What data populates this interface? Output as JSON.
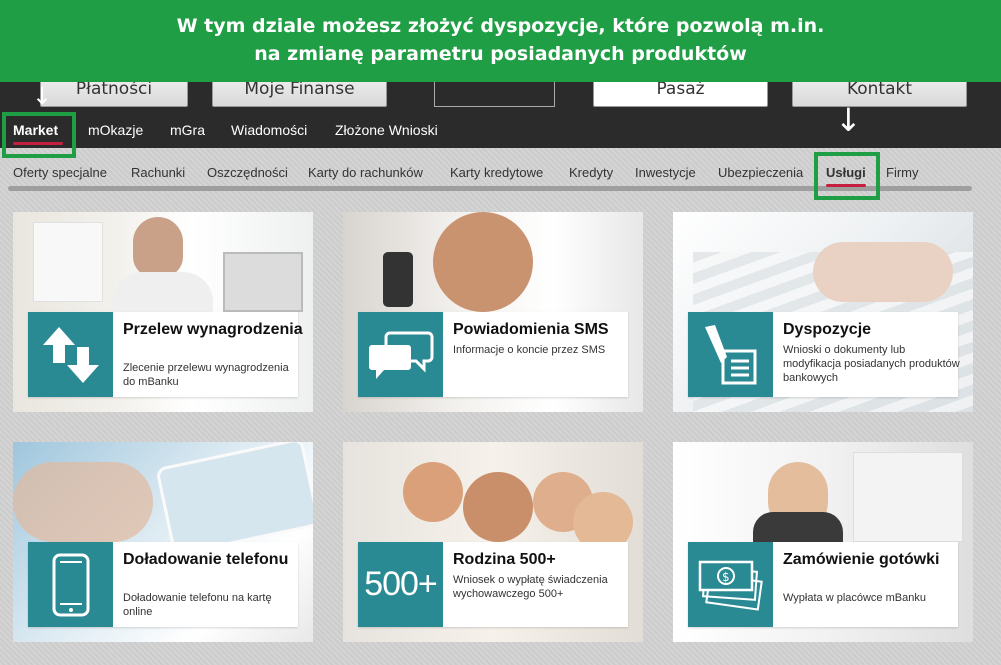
{
  "banner": {
    "line1": "W tym dziale możesz złożyć dyspozycje, które pozwolą m.in.",
    "line2": "na zmianę parametru posiadanych produktów"
  },
  "top_buttons": [
    "Płatności",
    "Moje Finanse",
    "Pasaż",
    "Kontakt"
  ],
  "nav_primary": [
    "Market",
    "mOkazje",
    "mGra",
    "Wiadomości",
    "Złożone Wnioski"
  ],
  "nav_secondary": [
    "Oferty specjalne",
    "Rachunki",
    "Oszczędności",
    "Karty do rachunków",
    "Karty kredytowe",
    "Kredyty",
    "Inwestycje",
    "Ubezpieczenia",
    "Usługi",
    "Firmy"
  ],
  "active": {
    "primary": "Market",
    "secondary": "Usługi"
  },
  "colors": {
    "highlight": "#1f9e45",
    "teal": "#2a8a93",
    "accent_red": "#c41f3e",
    "topbar": "#2b2b2b"
  },
  "cards": [
    {
      "title": "Przelew wynagrodzenia",
      "desc": "Zlecenie przelewu wynagrodzenia do mBanku",
      "icon": "transfer-arrows-icon"
    },
    {
      "title": "Powiadomienia SMS",
      "desc": "Informacje o koncie przez SMS",
      "icon": "chat-bubbles-icon"
    },
    {
      "title": "Dyspozycje",
      "desc": "Wnioski o dokumenty lub modyfikacja posiadanych produktów bankowych",
      "icon": "document-pen-icon"
    },
    {
      "title": "Doładowanie telefonu",
      "desc": "Doładowanie telefonu na kartę online",
      "icon": "smartphone-icon"
    },
    {
      "title": "Rodzina 500+",
      "desc": "Wniosek o wypłatę świadczenia wychowawczego 500+",
      "icon": "500-plus-icon",
      "icon_text": "500+"
    },
    {
      "title": "Zamówienie gotówki",
      "desc": "Wypłata w placówce mBanku",
      "icon": "banknotes-icon"
    }
  ]
}
